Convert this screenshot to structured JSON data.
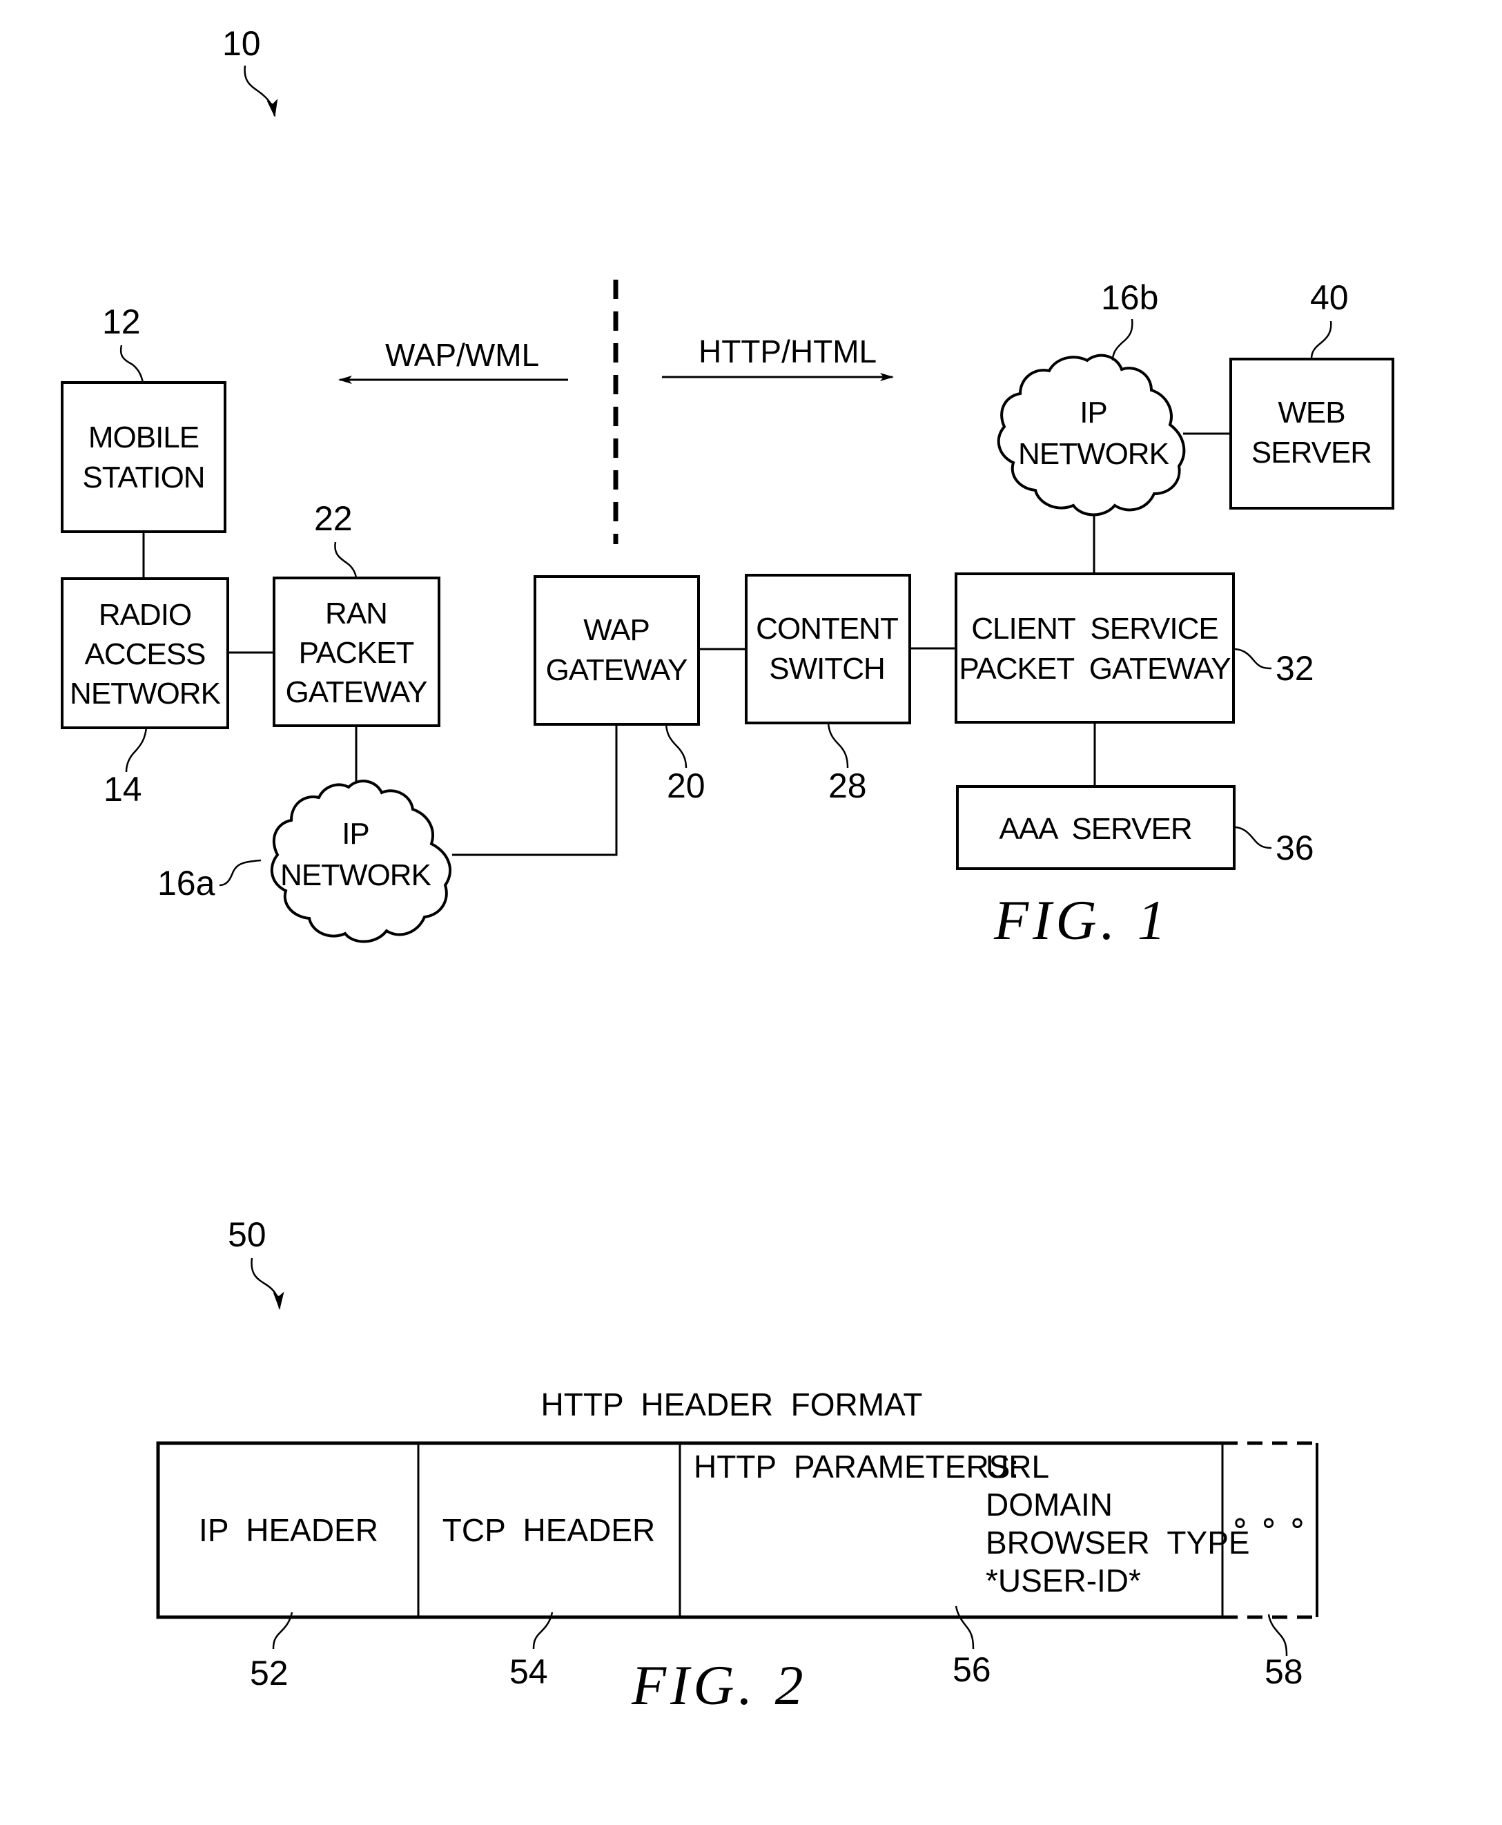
{
  "figure1": {
    "ref_number": "10",
    "caption": "FIG. 1",
    "protocols": {
      "left": "WAP/WML",
      "right": "HTTP/HTML"
    },
    "nodes": {
      "mobile_station": {
        "ref": "12",
        "lines": [
          "MOBILE",
          "STATION"
        ]
      },
      "radio_access_network": {
        "ref": "14",
        "lines": [
          "RADIO",
          "ACCESS",
          "NETWORK"
        ]
      },
      "ran_packet_gateway": {
        "ref": "22",
        "lines": [
          "RAN",
          "PACKET",
          "GATEWAY"
        ]
      },
      "ip_network_a": {
        "ref": "16a",
        "lines": [
          "IP",
          "NETWORK"
        ]
      },
      "wap_gateway": {
        "ref": "20",
        "lines": [
          "WAP",
          "GATEWAY"
        ]
      },
      "content_switch": {
        "ref": "28",
        "lines": [
          "CONTENT",
          "SWITCH"
        ]
      },
      "client_service_packet_gateway": {
        "ref": "32",
        "lines": [
          "CLIENT  SERVICE",
          "PACKET  GATEWAY"
        ]
      },
      "aaa_server": {
        "ref": "36",
        "lines": [
          "AAA  SERVER"
        ]
      },
      "ip_network_b": {
        "ref": "16b",
        "lines": [
          "IP",
          "NETWORK"
        ]
      },
      "web_server": {
        "ref": "40",
        "lines": [
          "WEB",
          "SERVER"
        ]
      }
    }
  },
  "figure2": {
    "ref_number": "50",
    "caption": "FIG. 2",
    "title": "HTTP  HEADER  FORMAT",
    "fields": [
      {
        "ref": "52",
        "label": "IP  HEADER"
      },
      {
        "ref": "54",
        "label": "TCP  HEADER"
      },
      {
        "ref": "56",
        "label": "HTTP  PARAMETERS:",
        "params": [
          "URL",
          "DOMAIN",
          "BROWSER  TYPE",
          "*USER-ID*"
        ]
      },
      {
        "ref": "58",
        "label": "∘ ∘ ∘"
      }
    ]
  }
}
